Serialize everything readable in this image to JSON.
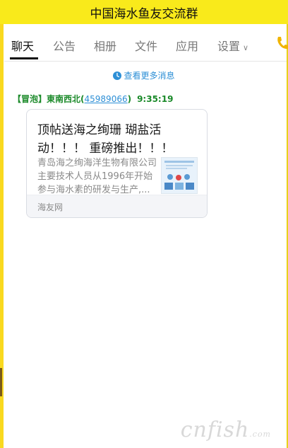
{
  "window": {
    "title": "中国海水鱼友交流群"
  },
  "tabs": [
    {
      "label": "聊天",
      "active": true
    },
    {
      "label": "公告"
    },
    {
      "label": "相册"
    },
    {
      "label": "文件"
    },
    {
      "label": "应用"
    },
    {
      "label": "设置"
    }
  ],
  "chat": {
    "more_messages": "查看更多消息",
    "message": {
      "sender_tag": "【冒泡】",
      "sender_name": "東南西北",
      "open_paren": "(",
      "qq_number": "45989066",
      "close_paren": ")",
      "time": "9:35:19",
      "card": {
        "title": "顶帖送海之绚珊 瑚盐活动！！！ 重磅推出！！！",
        "description": "青岛海之绚海洋生物有限公司主要技术人员从1996年开始参与海水素的研发与生产,...",
        "source": "海友网"
      }
    }
  },
  "watermark": {
    "brand": "cnfish",
    "suffix": ".com"
  },
  "colors": {
    "title_bar": "#f9ea1b",
    "link": "#2d8fd6",
    "sender": "#1b8a2a"
  }
}
